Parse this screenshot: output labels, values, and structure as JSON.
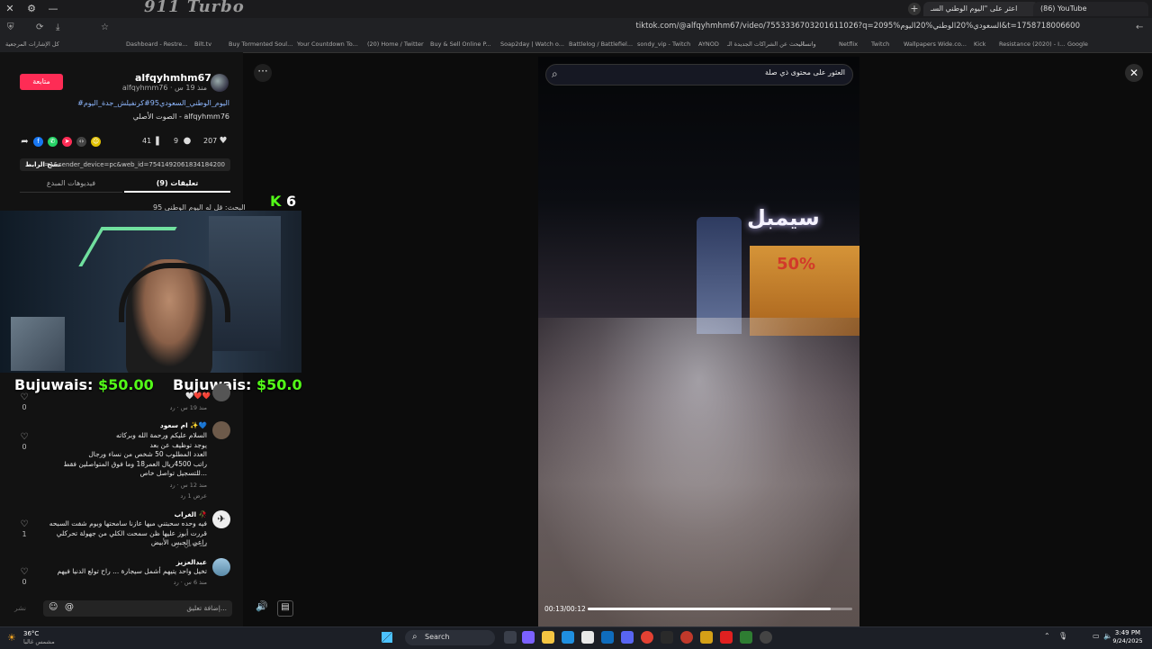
{
  "browser": {
    "brand_text": "911 Turbo",
    "tabs": [
      {
        "label": "اعثر على \"اليوم الوطني السـ"
      },
      {
        "label": "(86) YouTube"
      }
    ],
    "url": "tiktok.com/@alfqyhmhm67/video/7553336703201611026?q=2095%السعودي%20الوطني%20اليوم&t=1758718006600",
    "bookmarks": [
      "كل الإشارات المرجعية",
      "Dashboard - Restre...",
      "Bilt.tv",
      "Buy Tormented Soul...",
      "Your Countdown To...",
      "(20) Home / Twitter",
      "Buy & Sell Online P...",
      "Soap2day | Watch o...",
      "Battlelog / Battlefiel...",
      "sondy_vip - Twitch",
      "AYNOD",
      "البحث عن الشراكات الجديدة الـ...",
      "واتساب",
      "Netflix",
      "Twitch",
      "Wallpapers Wide.co...",
      "Kick",
      "Resistance (2020) - I...",
      "Google"
    ]
  },
  "post": {
    "follow_label": "متابعة",
    "username": "alfqyhmhm67",
    "subline": "alfqyhmm76 · منذ 19 س",
    "hashtags": "#اليوم_الوطني_السعودي95#كرنفيلش_جدة_اليوم",
    "music": "الصوت الأصلي - alfqyhmm76",
    "likes": "207",
    "comments": "9",
    "saves": "41",
    "copy_link_label": "نسخ الرابط",
    "link_text": "=1&sender_device=pc&web_id=7541492061834184200",
    "tab_comments": "تعليقات (9)",
    "tab_creator": "فيديوهات المبدع",
    "search_banner": "البحث: قل له اليوم الوطني 95"
  },
  "stream_overlay": {
    "kick_letter": "K",
    "kick_count": "6",
    "donations": [
      {
        "name": "Bujuwais:",
        "amount": "$50.00"
      },
      {
        "name": "Bujuwais:",
        "amount": "$50.00"
      }
    ]
  },
  "comments": [
    {
      "name": "",
      "text": "🤍❤️❤️",
      "meta": "منذ 19 س · رد",
      "likes": "0"
    },
    {
      "name": "ام سعود ✨💙",
      "text": "السلام عليكم ورحمة الله وبركاته|يوجد توظيف عن بعد|العدد المطلوب 50 شخص من نساء ورجال|راتب 4500ريال العمر18 وما فوق المتواصلين فقط للتسجيل تواصل خاص...",
      "meta": "منذ 12 س · رد",
      "likes": "0",
      "replies": "عرض 1 رد"
    },
    {
      "name": "الغراب 🥀",
      "text": "فيه وحده سحبتني مبها عازنا سامحتها وبوم شفت السبحه قررت أبوز عليها ظن سمحت الكلي من جهولة تحركلي راعي الجبس الأبيض",
      "meta": "منذ 6 س · رد",
      "likes": "1"
    },
    {
      "name": "عبدالعزيز",
      "text": "تخيل واحد يتيهم أشمل سيجارة ... راح تولع الدنيا فيهم",
      "meta": "منذ 6 س · رد",
      "likes": "0"
    }
  ],
  "composer": {
    "placeholder": "إضافة تعليق...",
    "post_label": "نشر"
  },
  "video": {
    "search_placeholder": "العثور على محتوى ذي صلة",
    "sign_text": "سيمبل",
    "sale_text": "50%",
    "timecode": "00:13/00:12",
    "progress": 0.92
  },
  "taskbar": {
    "weather_temp": "36°C",
    "weather_desc": "مشمس غالبا",
    "search_label": "Search",
    "time": "3:49 PM",
    "date": "9/24/2025"
  },
  "colors": {
    "accent": "#fe2c55",
    "kick": "#53fc18"
  }
}
